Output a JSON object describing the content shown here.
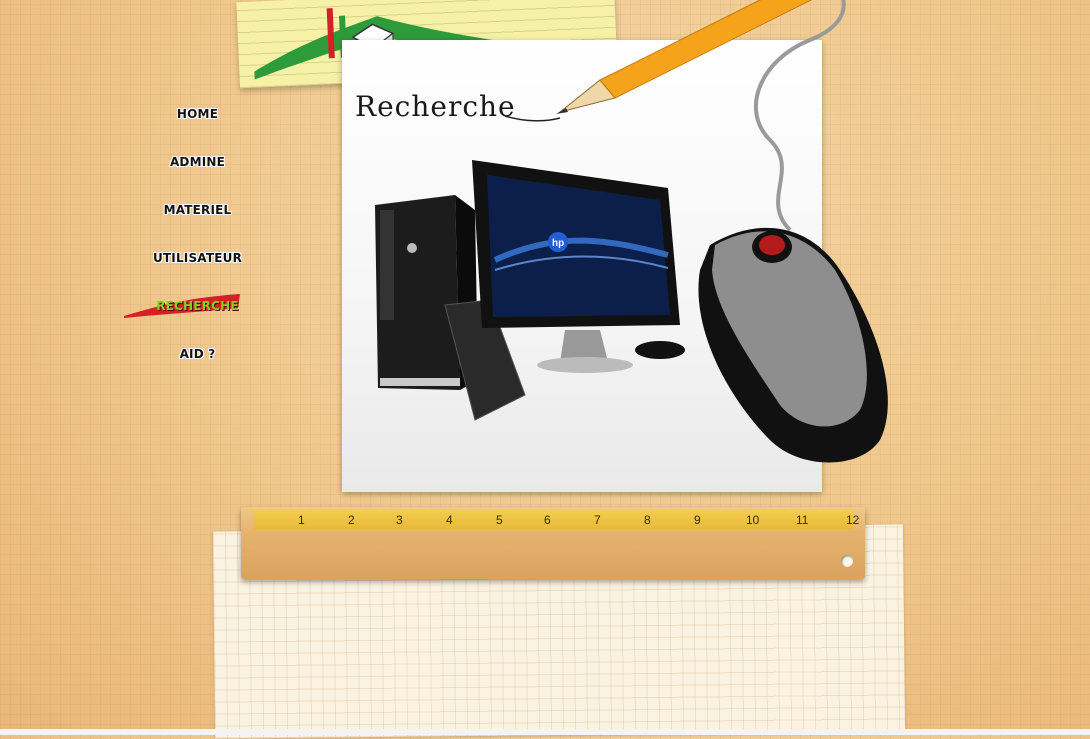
{
  "page": {
    "title": "Recherche"
  },
  "menu": {
    "items": [
      {
        "label": "HOME"
      },
      {
        "label": "ADMINE"
      },
      {
        "label": "MATERIEL"
      },
      {
        "label": "UTILISATEUR"
      },
      {
        "label": "RECHERCHE",
        "active": true
      },
      {
        "label": "AID ?"
      }
    ]
  },
  "hardware": {
    "monitor_brand": "hp"
  },
  "ruler": {
    "numbers": [
      "1",
      "2",
      "3",
      "4",
      "5",
      "6",
      "7",
      "8",
      "9",
      "10",
      "11",
      "12"
    ]
  },
  "colors": {
    "active_menu": "#7ed321",
    "brush": "#d61f26"
  }
}
